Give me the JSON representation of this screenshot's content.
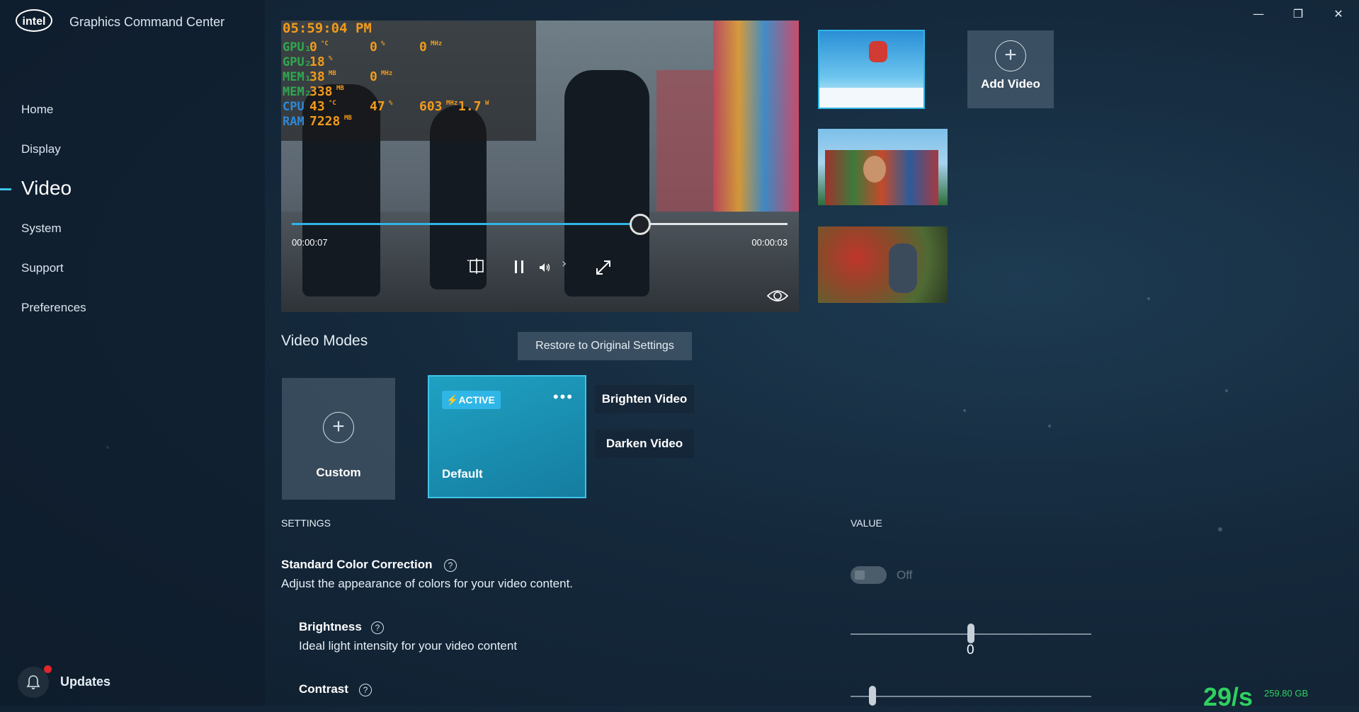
{
  "app": {
    "logo_text": "intel",
    "title": "Graphics Command Center"
  },
  "window_controls": {
    "minimize": "—",
    "restore": "❐",
    "close": "✕"
  },
  "nav": {
    "items": [
      {
        "label": "Home"
      },
      {
        "label": "Display"
      },
      {
        "label": "Video",
        "active": true
      },
      {
        "label": "System"
      },
      {
        "label": "Support"
      },
      {
        "label": "Preferences"
      }
    ],
    "updates_label": "Updates"
  },
  "player": {
    "overlay": {
      "clock": "05:59:04 PM",
      "rows": [
        {
          "label": "GPU₁",
          "color": "#2fa84f",
          "vals": [
            [
              "0",
              "°C"
            ],
            [
              "0",
              "%"
            ],
            [
              "0",
              "MHz"
            ]
          ]
        },
        {
          "label": "GPU₂",
          "color": "#2fa84f",
          "vals": [
            [
              "18",
              "%"
            ]
          ]
        },
        {
          "label": "MEM₁",
          "color": "#2fa84f",
          "vals": [
            [
              "38",
              "MB"
            ],
            [
              "0",
              "MHz"
            ]
          ]
        },
        {
          "label": "MEM₂",
          "color": "#2fa84f",
          "vals": [
            [
              "338",
              "MB"
            ]
          ]
        },
        {
          "label": "CPU",
          "color": "#2f87d6",
          "vals": [
            [
              "43",
              "°C"
            ],
            [
              "47",
              "%"
            ],
            [
              "603",
              "MHz"
            ],
            [
              "1.7",
              "W"
            ]
          ]
        },
        {
          "label": "RAM",
          "color": "#2f87d6",
          "vals": [
            [
              "7228",
              "MB"
            ]
          ]
        }
      ]
    },
    "elapsed": "00:00:07",
    "remaining": "00:00:03",
    "progress": 0.7
  },
  "thumbnails": [
    {
      "name": "snowboarder-thumbnail",
      "selected": true
    },
    {
      "name": "crowd-thumbnail",
      "selected": false
    },
    {
      "name": "market-thumbnail",
      "selected": false
    }
  ],
  "add_video_label": "Add Video",
  "video_modes": {
    "title": "Video Modes",
    "restore_label": "Restore to Original Settings",
    "custom_label": "Custom",
    "default_label": "Default",
    "active_badge": "ACTIVE",
    "presets": [
      "Brighten Video",
      "Darken Video"
    ]
  },
  "settings": {
    "settings_header": "SETTINGS",
    "value_header": "VALUE",
    "color_correction": {
      "title": "Standard Color Correction",
      "desc": "Adjust the appearance of colors for your video content.",
      "state": "Off"
    },
    "brightness": {
      "title": "Brightness",
      "desc": "Ideal light intensity for your video content",
      "value": "0",
      "level": 0.5
    },
    "contrast": {
      "title": "Contrast",
      "level": 0.09
    }
  },
  "status": {
    "speed": "29/s",
    "disk": "259.80 GB"
  },
  "colors": {
    "accent": "#2fb6e6",
    "toggle_off": "#4b5c6a",
    "speed_green": "#2fd060"
  }
}
